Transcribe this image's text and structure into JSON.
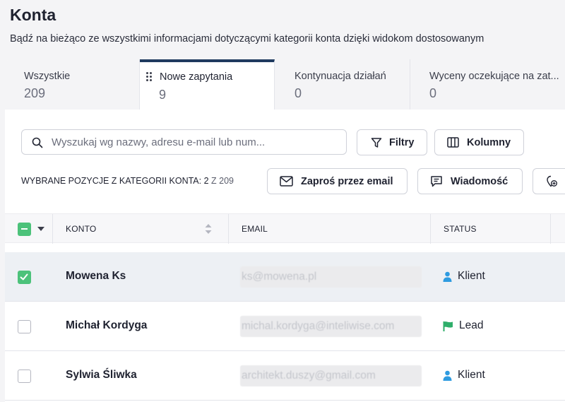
{
  "header": {
    "title": "Konta",
    "subtitle": "Bądź na bieżąco ze wszystkimi informacjami dotyczącymi kategorii konta dzięki widokom dostosowanym"
  },
  "tabs": [
    {
      "label": "Wszystkie",
      "count": "209"
    },
    {
      "label": "Nowe zapytania",
      "count": "9"
    },
    {
      "label": "Kontynuacja działań",
      "count": "0"
    },
    {
      "label": "Wyceny oczekujące na zat...",
      "count": "0"
    }
  ],
  "search": {
    "placeholder": "Wyszukaj wg nazwy, adresu e-mail lub num..."
  },
  "toolbar": {
    "filters_label": "Filtry",
    "columns_label": "Kolumny",
    "selection_prefix": "WYBRANE POZYCJE Z KATEGORII KONTA: ",
    "selection_count": "2",
    "selection_total": " Z 209",
    "invite_label": "Zaproś przez email",
    "message_label": "Wiadomość"
  },
  "table": {
    "headers": {
      "account": "KONTO",
      "email": "EMAIL",
      "status": "STATUS"
    },
    "rows": [
      {
        "name": "Mowena Ks",
        "email": "ks@mowena.pl",
        "status": "Klient",
        "status_icon": "person-icon",
        "checked": true
      },
      {
        "name": "Michał Kordyga",
        "email": "michal.kordyga@inteliwise.com",
        "status": "Lead",
        "status_icon": "flag-icon",
        "checked": false
      },
      {
        "name": "Sylwia Śliwka",
        "email": "architekt.duszy@gmail.com",
        "status": "Klient",
        "status_icon": "person-icon",
        "checked": false
      }
    ]
  },
  "colors": {
    "accent": "#1f3a5f",
    "check_green": "#4cc27a",
    "client_blue": "#2e9be0",
    "lead_green": "#2fae6a"
  }
}
